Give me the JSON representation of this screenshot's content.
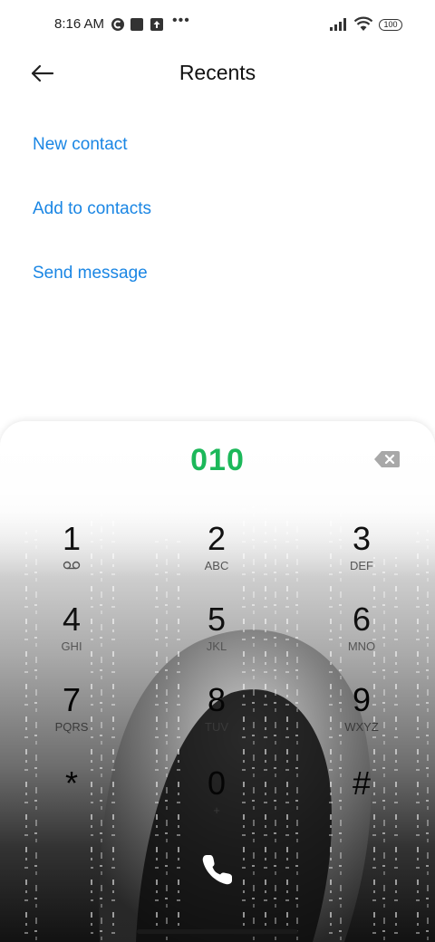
{
  "status_bar": {
    "time": "8:16 AM",
    "battery": "100",
    "icons": [
      "notification-c-icon",
      "app-square-icon",
      "upload-icon",
      "more-dots-icon",
      "signal-icon",
      "wifi-icon",
      "battery-icon"
    ]
  },
  "header": {
    "title": "Recents",
    "back_icon": "arrow-left-icon"
  },
  "actions": [
    {
      "label": "New contact"
    },
    {
      "label": "Add to contacts"
    },
    {
      "label": "Send message"
    }
  ],
  "dialpad": {
    "number": "010",
    "backspace_icon": "backspace-icon",
    "keys": [
      {
        "digit": "1",
        "letters": ""
      },
      {
        "digit": "2",
        "letters": "ABC"
      },
      {
        "digit": "3",
        "letters": "DEF"
      },
      {
        "digit": "4",
        "letters": "GHI"
      },
      {
        "digit": "5",
        "letters": "JKL"
      },
      {
        "digit": "6",
        "letters": "MNO"
      },
      {
        "digit": "7",
        "letters": "PQRS"
      },
      {
        "digit": "8",
        "letters": "TUV"
      },
      {
        "digit": "9",
        "letters": "WXYZ"
      },
      {
        "digit": "*",
        "letters": ""
      },
      {
        "digit": "0",
        "letters": "+"
      },
      {
        "digit": "#",
        "letters": ""
      }
    ],
    "call_icon": "phone-icon",
    "colors": {
      "number": "#1cb85a",
      "action_link": "#1a86e4"
    }
  }
}
